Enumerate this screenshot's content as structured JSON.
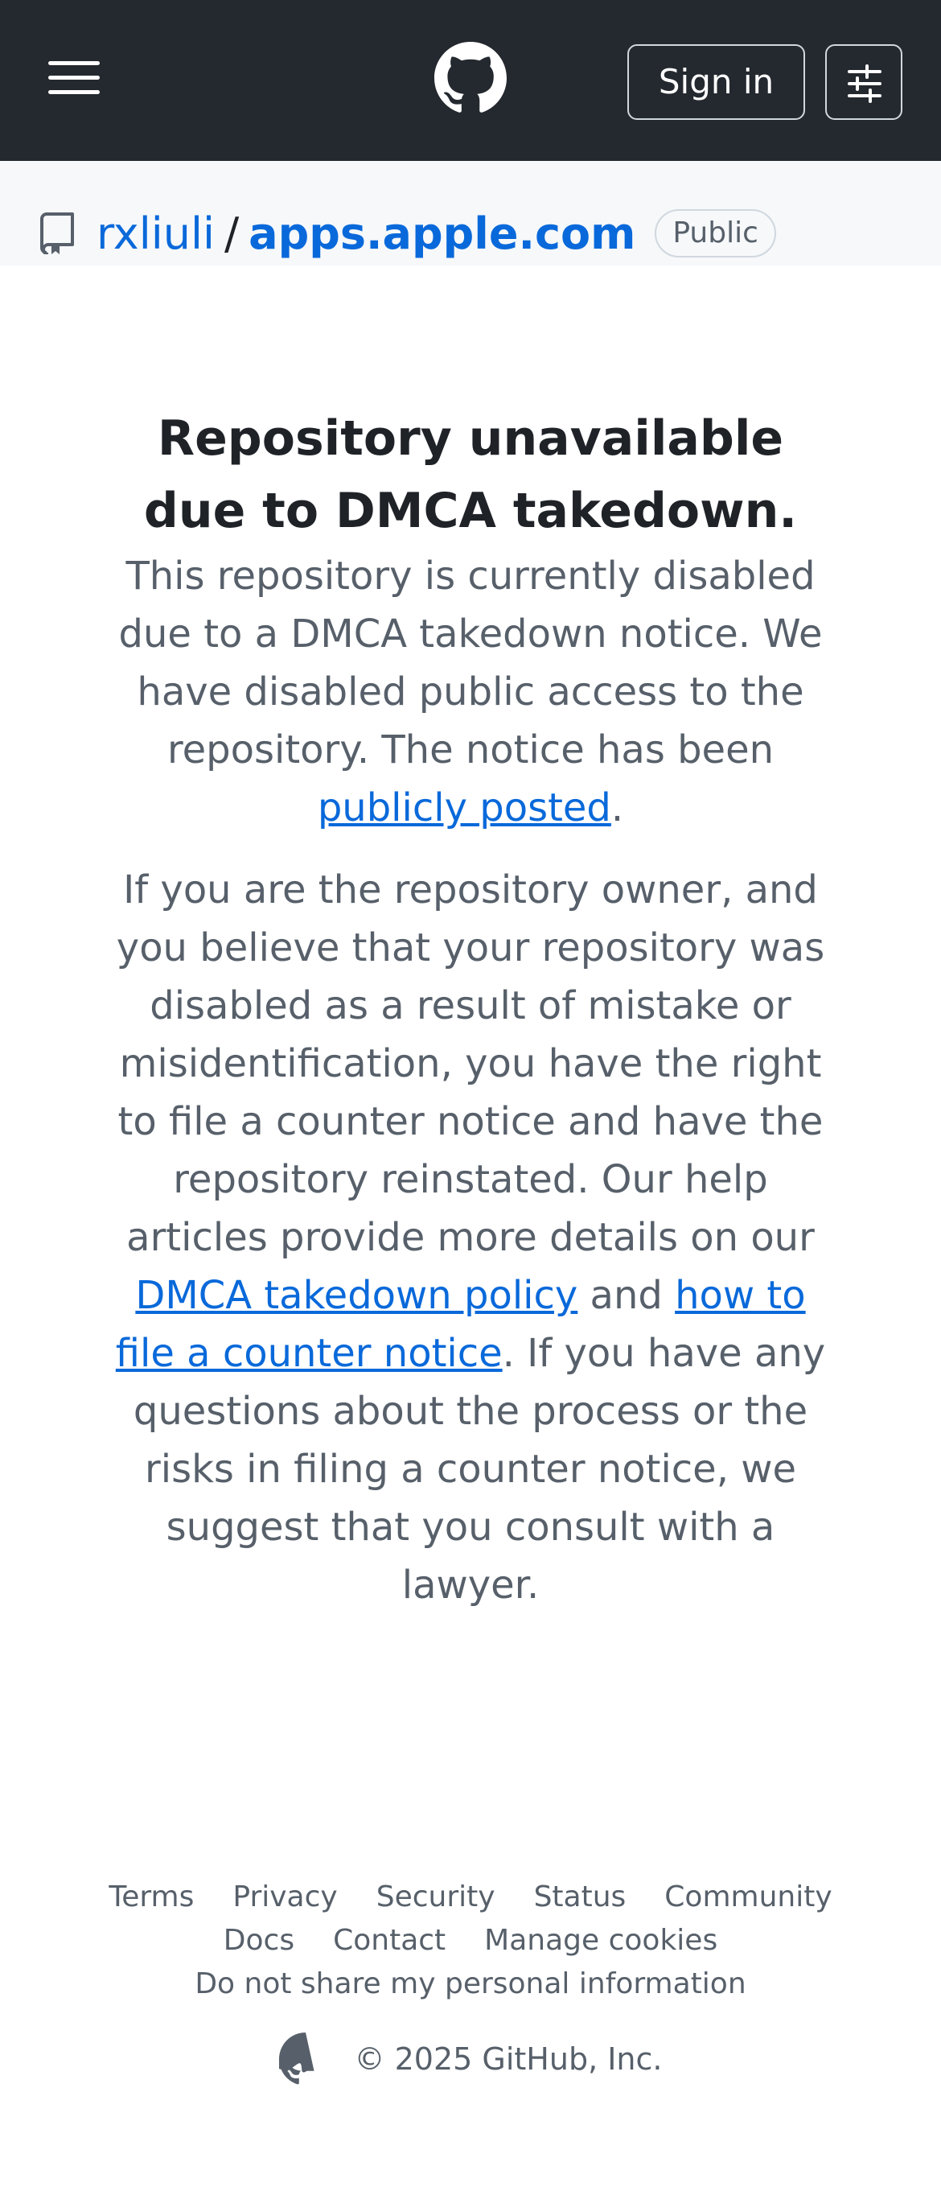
{
  "header": {
    "menu_icon": "hamburger-menu-icon",
    "logo_icon": "github-logo-icon",
    "sign_in_label": "Sign in",
    "settings_icon": "sliders-icon",
    "background": "#24292f"
  },
  "repo": {
    "icon": "repo-icon",
    "owner": "rxliuli",
    "separator": "/",
    "name": "apps.apple.com",
    "visibility": "Public"
  },
  "main": {
    "title_line1": "Repository unavailable",
    "title_line2": "due to DMCA takedown.",
    "para1_text": "This repository is currently disabled due to a DMCA takedown notice. We have disabled public access to the repository. The notice has been ",
    "para1_link": "publicly posted",
    "para1_end": ".",
    "para2_text": "If you are the repository owner, and you believe that your repository was disabled as a result of mistake or misidentification, you have the right to file a counter notice and have the repository reinstated. Our help articles provide more details on our ",
    "para2_link1": "DMCA takedown policy",
    "para2_mid": " and ",
    "para2_link2": "how to file a counter notice",
    "para2_end": ". If you have any questions about the process or the risks in filing a counter notice, we suggest that you consult with a lawyer."
  },
  "footer": {
    "links_row1": [
      "Terms",
      "Privacy",
      "Security",
      "Status",
      "Community"
    ],
    "links_row2": [
      "Docs",
      "Contact",
      "Manage cookies"
    ],
    "links_row3": "Do not share my personal information",
    "copyright": "© 2025 GitHub, Inc.",
    "logo_icon": "github-logo-icon"
  },
  "colors": {
    "link": "#0969da",
    "muted": "#57606a",
    "text": "#1f2328"
  }
}
